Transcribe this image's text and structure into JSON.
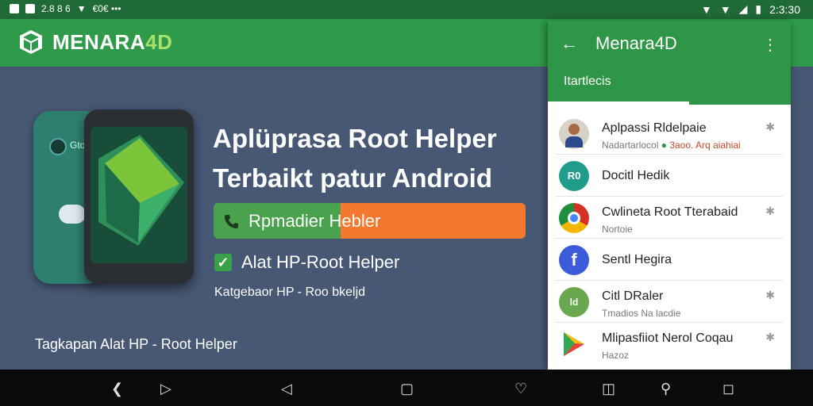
{
  "status_bar": {
    "left_text": "2.8 8 6",
    "left_text2": "€0€ •••",
    "time": "2:3:30"
  },
  "app_bar": {
    "brand_main": "MENARA",
    "brand_accent": "4D"
  },
  "hero": {
    "headline_line1": "Aplüprasa Root Helper",
    "headline_line2": "Terbaikt patur Android",
    "cta_label": "Rpmadier Hebler",
    "checkbox_label": "Alat HP-Root Helper",
    "category": "Katgebaor HP - Roo bkeljd",
    "caption": "Tagkapan Alat HP - Root Helper",
    "phone_back_label": "Gto"
  },
  "panel": {
    "title": "Menara4D",
    "tab_label": "Itartlecis",
    "items": [
      {
        "title": "Aplpassi Rldelpaie",
        "subtitle": "Nadartarlocol",
        "subtitle2": "3aoo. Arq aiahiai",
        "avatar_type": "person",
        "starred": true
      },
      {
        "title": "Docitl Hedik",
        "subtitle": "",
        "avatar_type": "r-badge",
        "avatar_text": "R0",
        "starred": false
      },
      {
        "title": "Cwlineta Root Tterabaid",
        "subtitle": "Nortoie",
        "avatar_type": "chrome",
        "starred": true
      },
      {
        "title": "Sentl Hegira",
        "subtitle": "",
        "avatar_type": "facebook",
        "avatar_text": "f",
        "starred": false
      },
      {
        "title": "Citl DRaler",
        "subtitle": "Tmadios Na lacdie",
        "avatar_type": "green-dot",
        "avatar_text": "ld",
        "starred": true
      },
      {
        "title": "Mlipasfiiot Nerol Coqau",
        "subtitle": "Hazoz",
        "avatar_type": "play",
        "starred": true
      }
    ]
  },
  "colors": {
    "app_green": "#2f9a4a",
    "status_green": "#1f6a37",
    "background": "#475874",
    "cta_orange": "#f4782e",
    "accent_lime": "#a6e26b"
  }
}
